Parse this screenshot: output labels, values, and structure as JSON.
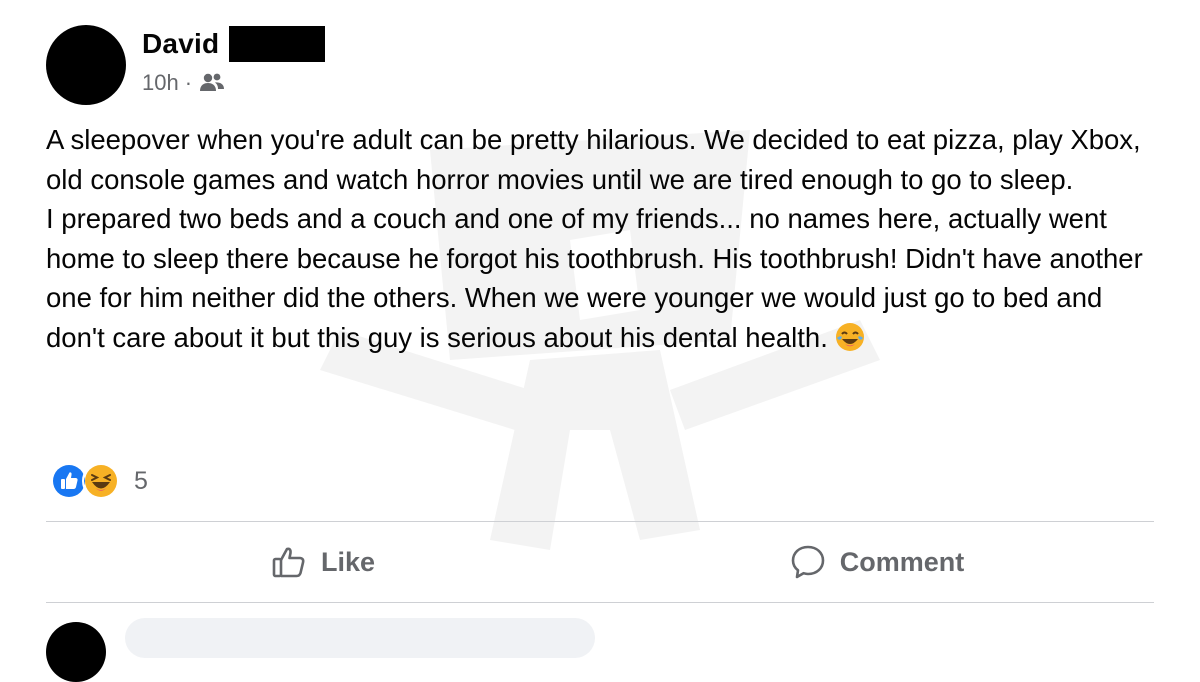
{
  "post": {
    "author_name": "David",
    "timestamp": "10h",
    "meta_separator": "·",
    "audience_icon": "friends-icon",
    "paragraphs": [
      "A sleepover when you're adult can be pretty hilarious. We decided to eat pizza, play Xbox, old console games and watch horror movies until we are tired enough to go to sleep.",
      "I prepared two beds and a couch and one of my friends... no names here, actually went home to sleep there because he forgot his toothbrush. His toothbrush! Didn't have another one for him neither did the others. When we were younger we would just go to bed and don't care about it but this guy is serious about his dental health."
    ],
    "inline_emoji": "tears-of-joy-emoji"
  },
  "reactions": {
    "icons": [
      "like-reaction-icon",
      "haha-reaction-icon"
    ],
    "count": "5"
  },
  "actions": {
    "like_label": "Like",
    "comment_label": "Comment"
  },
  "colors": {
    "text": "#050505",
    "secondary": "#65676b",
    "like_blue": "#1877f2",
    "haha_yellow": "#f7b125",
    "divider": "#ced0d4"
  }
}
